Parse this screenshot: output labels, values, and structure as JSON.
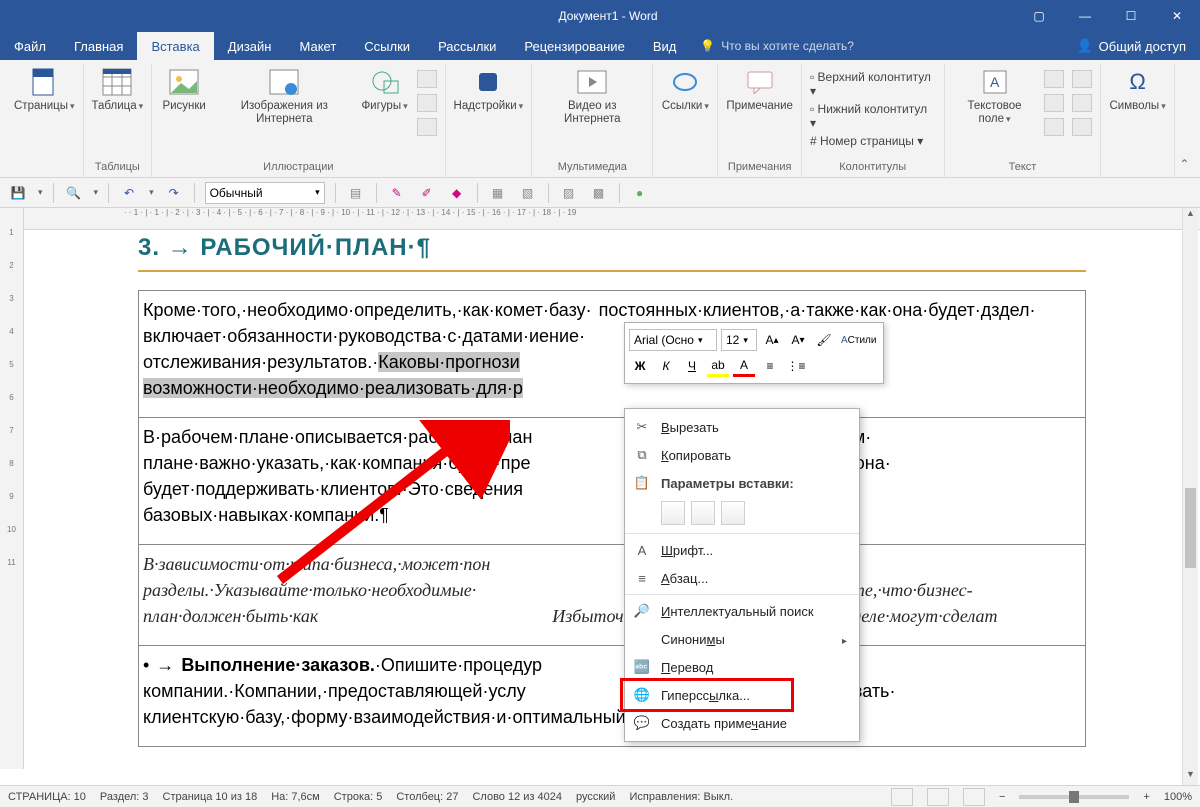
{
  "titlebar": {
    "title": "Документ1 - Word"
  },
  "tabs": [
    "Файл",
    "Главная",
    "Вставка",
    "Дизайн",
    "Макет",
    "Ссылки",
    "Рассылки",
    "Рецензирование",
    "Вид"
  ],
  "active_tab": "Вставка",
  "tellme": "Что вы хотите сделать?",
  "share": "Общий доступ",
  "ribbon": {
    "groups": [
      {
        "label": "",
        "items": [
          {
            "label": "Страницы",
            "big": true
          }
        ]
      },
      {
        "label": "Таблицы",
        "items": [
          {
            "label": "Таблица",
            "big": true
          }
        ]
      },
      {
        "label": "Иллюстрации",
        "items": [
          {
            "label": "Рисунки"
          },
          {
            "label": "Изображения из Интернета"
          },
          {
            "label": "Фигуры"
          }
        ]
      },
      {
        "label": "",
        "items": [
          {
            "label": "Надстройки"
          }
        ]
      },
      {
        "label": "Мультимедиа",
        "items": [
          {
            "label": "Видео из Интернета"
          }
        ]
      },
      {
        "label": "",
        "items": [
          {
            "label": "Ссылки"
          }
        ]
      },
      {
        "label": "Примечания",
        "items": [
          {
            "label": "Примечание"
          }
        ]
      },
      {
        "label": "Колонтитулы",
        "items_text": [
          "Верхний колонтитул",
          "Нижний колонтитул",
          "Номер страницы"
        ]
      },
      {
        "label": "Текст",
        "items": [
          {
            "label": "Текстовое поле"
          }
        ]
      },
      {
        "label": "",
        "items": [
          {
            "label": "Символы"
          }
        ]
      }
    ]
  },
  "qat": {
    "style_combo": "Обычный"
  },
  "document": {
    "heading": "3. → РАБОЧИЙ·ПЛАН·¶",
    "p1_pre": "Кроме·того,·необходимо·определить,·как·ком",
    "p1_mid": "ет·базу· постоянных·клиентов,·а·также·как·она·будет·д",
    "p1_mid2": "здел· включает·обязанности·руководства·с·датами·и",
    "p1_mid3": "ение· отслеживания·результатов.·",
    "p1_hl": "Каковы·прогнози",
    "p1_hl2": "оста·и·какие· возможности·необходимо·реализовать·для·р",
    "p2": "В·рабочем·плане·описывается·работа·компан                                    ии·в·этом· плане·важно·указать,·как·компания·будет·пре                                    ке·и·как·она· будет·поддерживать·клиентов.·Это·сведения                                    ·а·также· базовых·навыках·компании.¶",
    "p3": "В·зависимости·от·типа·бизнеса,·может·пон                                    следующие· разделы.·Указывайте·только·необходимые·                                    стальные.· Помните,·что·бизнес-план·должен·быть·как                                    Избыточные· подробности·в·этом·разделе·могут·сделат",
    "p4_b": "Выполнение·заказов.",
    "p4": "·Опишите·процедур                                    ентам· компании.·Компании,·предоставляющей·услу                                    ·отслеживать· клиентскую·базу,·форму·взаимодействия·и·оптимальный·способ·управления·"
  },
  "minitoolbar": {
    "font": "Arial (Осно",
    "size": "12",
    "styles_label": "Стили",
    "bold": "Ж",
    "italic": "К",
    "underline": "Ч"
  },
  "context_menu": {
    "cut": "Вырезать",
    "copy": "Копировать",
    "paste_header": "Параметры вставки:",
    "font": "Шрифт...",
    "para": "Абзац...",
    "smartlookup": "Интеллектуальный поиск",
    "synonyms": "Синонимы",
    "translate": "Перевод",
    "hyperlink": "Гиперссылка...",
    "comment": "Создать примечание"
  },
  "status": {
    "page": "СТРАНИЦА: 10",
    "section": "Раздел: 3",
    "pageof": "Страница 10 из 18",
    "at": "На: 7,6см",
    "line": "Строка: 5",
    "col": "Столбец: 27",
    "words": "Слово 12 из 4024",
    "lang": "русский",
    "track": "Исправления: Выкл.",
    "zoom": "100%"
  },
  "hruler": "· · 1 · | · 1 · | · 2 · | · 3 · | · 4 · | · 5 · | · 6 · | · 7 · | · 8 · | · 9 · | · 10 · | · 11 · | · 12 · | · 13 · | · 14 · | · 15 · | · 16 · | · 17 · | · 18 · | · 19",
  "vruler": [
    "1",
    "·",
    "2",
    "·",
    "3",
    "·",
    "4",
    "·",
    "5",
    "·",
    "6",
    "·",
    "7",
    "·",
    "8",
    "·",
    "9",
    "·",
    "10",
    "·",
    "11"
  ]
}
